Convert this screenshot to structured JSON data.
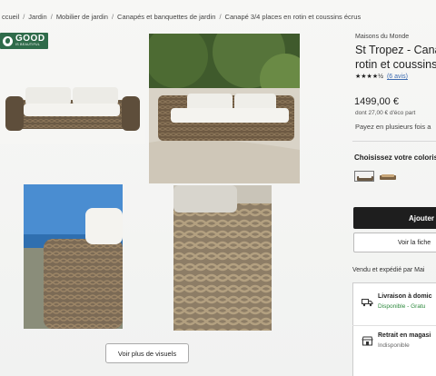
{
  "breadcrumb": [
    "ccueil",
    "Jardin",
    "Mobilier de jardin",
    "Canapés et banquettes de jardin",
    "Canapé 3/4 places en rotin et coussins écrus"
  ],
  "logo": {
    "big": "GOOD",
    "small": "IS BEAUTIFUL"
  },
  "gallery": {
    "more_label": "Voir plus de visuels"
  },
  "product": {
    "brand": "Maisons du Monde",
    "title_line1": "St Tropez - Cana",
    "title_line2": "rotin et coussins",
    "rating_stars": "★★★★½",
    "reviews": "(6 avis)",
    "price": "1499,00 €",
    "eco_part": "dont 27,00 € d'éco part",
    "payment": "Payez en plusieurs fois a",
    "color_label": "Choisissez votre coloris",
    "add_label": "Ajouter",
    "sheet_label": "Voir la fiche",
    "sold_by": "Vendu et expédié par Mai"
  },
  "delivery": {
    "home": {
      "title": "Livraison à domic",
      "status": "Disponible - Gratu"
    },
    "store": {
      "title": "Retrait en magasi",
      "status": "Indisponible"
    }
  },
  "colors": {
    "available": "#2e8a3e",
    "unavailable": "#666666",
    "add_button": "#1e1e1e",
    "logo": "#2f6b4a"
  }
}
